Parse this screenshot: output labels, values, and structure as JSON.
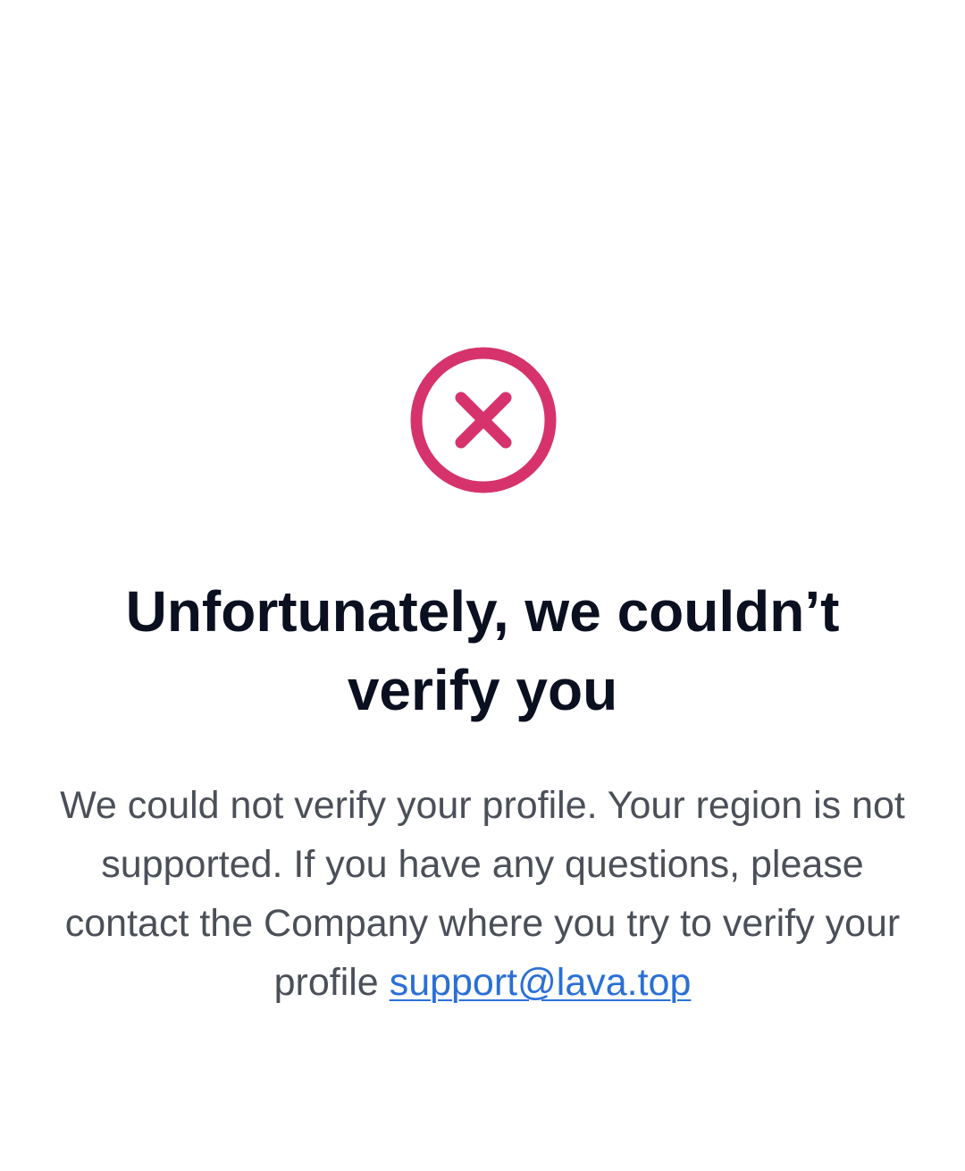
{
  "status": {
    "icon": "close-circle-icon",
    "color": "#d6336c"
  },
  "title": "Unfortunately, we couldn’t verify you",
  "message": {
    "text": "We could not verify your profile. Your region is not supported. If you have any questions, please contact the Company where you try to verify your profile ",
    "link_label": "support@lava.top"
  },
  "colors": {
    "title": "#0b1020",
    "body_text": "#4b4f58",
    "link": "#2b6fd6",
    "background": "#ffffff"
  }
}
